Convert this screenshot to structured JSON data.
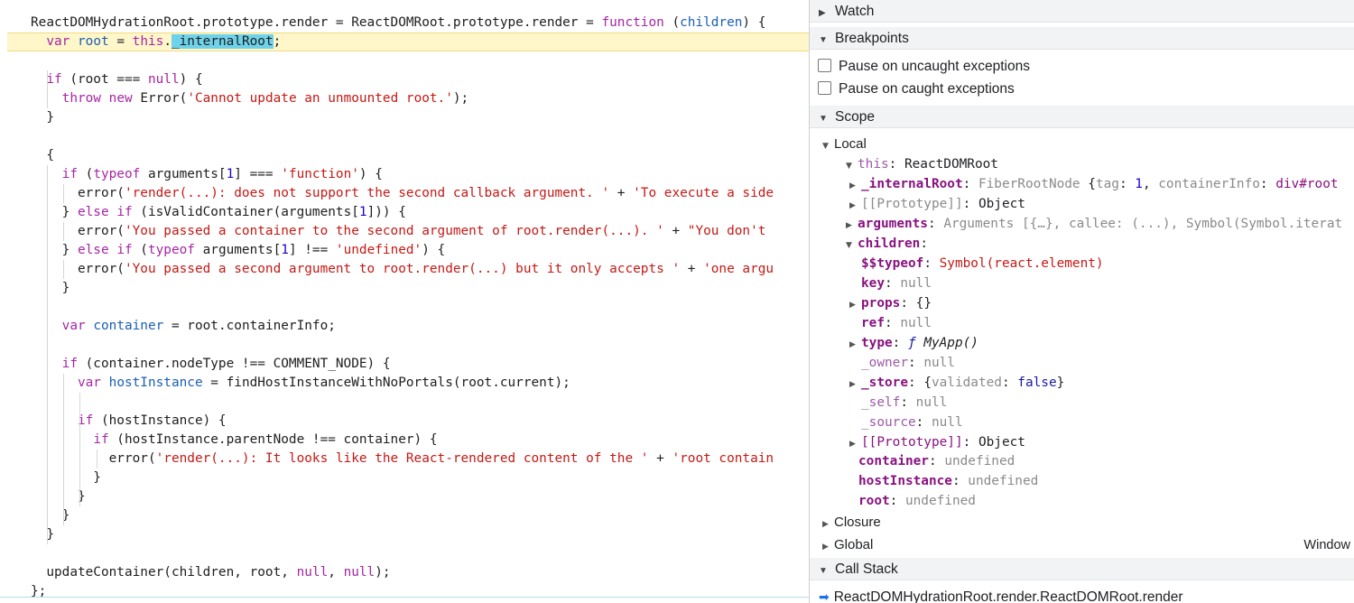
{
  "editor": {
    "lines": [
      [
        {
          "t": "ReactDOMHydrationRoot.prototype.render = ReactDOMRoot.prototype.render = "
        },
        {
          "t": "function",
          "c": "kw"
        },
        {
          "t": " ("
        },
        {
          "t": "children",
          "c": "var"
        },
        {
          "t": ") {"
        }
      ],
      [
        {
          "t": "  "
        },
        {
          "t": "var",
          "c": "kw"
        },
        {
          "t": " "
        },
        {
          "t": "root",
          "c": "var"
        },
        {
          "t": " = "
        },
        {
          "t": "this",
          "c": "kw"
        },
        {
          "t": "."
        },
        {
          "t": "_internalRoot",
          "c": "sel"
        },
        {
          "t": ";"
        }
      ],
      [
        {
          "t": ""
        }
      ],
      [
        {
          "t": "  "
        },
        {
          "t": "if",
          "c": "kw"
        },
        {
          "t": " (root === "
        },
        {
          "t": "null",
          "c": "kw"
        },
        {
          "t": ") {"
        }
      ],
      [
        {
          "t": "    "
        },
        {
          "t": "throw",
          "c": "kw"
        },
        {
          "t": " "
        },
        {
          "t": "new",
          "c": "kw"
        },
        {
          "t": " Error("
        },
        {
          "t": "'Cannot update an unmounted root.'",
          "c": "str"
        },
        {
          "t": ");"
        }
      ],
      [
        {
          "t": "  }"
        }
      ],
      [
        {
          "t": ""
        }
      ],
      [
        {
          "t": "  {"
        }
      ],
      [
        {
          "t": "    "
        },
        {
          "t": "if",
          "c": "kw"
        },
        {
          "t": " ("
        },
        {
          "t": "typeof",
          "c": "kw"
        },
        {
          "t": " arguments["
        },
        {
          "t": "1",
          "c": "num"
        },
        {
          "t": "] === "
        },
        {
          "t": "'function'",
          "c": "str"
        },
        {
          "t": ") {"
        }
      ],
      [
        {
          "t": "      error("
        },
        {
          "t": "'render(...): does not support the second callback argument. '",
          "c": "str"
        },
        {
          "t": " + "
        },
        {
          "t": "'To execute a side",
          "c": "str"
        }
      ],
      [
        {
          "t": "    } "
        },
        {
          "t": "else",
          "c": "kw"
        },
        {
          "t": " "
        },
        {
          "t": "if",
          "c": "kw"
        },
        {
          "t": " (isValidContainer(arguments["
        },
        {
          "t": "1",
          "c": "num"
        },
        {
          "t": "])) {"
        }
      ],
      [
        {
          "t": "      error("
        },
        {
          "t": "'You passed a container to the second argument of root.render(...). '",
          "c": "str"
        },
        {
          "t": " + "
        },
        {
          "t": "\"You don't",
          "c": "str"
        }
      ],
      [
        {
          "t": "    } "
        },
        {
          "t": "else",
          "c": "kw"
        },
        {
          "t": " "
        },
        {
          "t": "if",
          "c": "kw"
        },
        {
          "t": " ("
        },
        {
          "t": "typeof",
          "c": "kw"
        },
        {
          "t": " arguments["
        },
        {
          "t": "1",
          "c": "num"
        },
        {
          "t": "] !== "
        },
        {
          "t": "'undefined'",
          "c": "str"
        },
        {
          "t": ") {"
        }
      ],
      [
        {
          "t": "      error("
        },
        {
          "t": "'You passed a second argument to root.render(...) but it only accepts '",
          "c": "str"
        },
        {
          "t": " + "
        },
        {
          "t": "'one argu",
          "c": "str"
        }
      ],
      [
        {
          "t": "    }"
        }
      ],
      [
        {
          "t": ""
        }
      ],
      [
        {
          "t": "    "
        },
        {
          "t": "var",
          "c": "kw"
        },
        {
          "t": " "
        },
        {
          "t": "container",
          "c": "var"
        },
        {
          "t": " = root.containerInfo;"
        }
      ],
      [
        {
          "t": ""
        }
      ],
      [
        {
          "t": "    "
        },
        {
          "t": "if",
          "c": "kw"
        },
        {
          "t": " (container.nodeType !== COMMENT_NODE) {"
        }
      ],
      [
        {
          "t": "      "
        },
        {
          "t": "var",
          "c": "kw"
        },
        {
          "t": " "
        },
        {
          "t": "hostInstance",
          "c": "var"
        },
        {
          "t": " = findHostInstanceWithNoPortals(root.current);"
        }
      ],
      [
        {
          "t": ""
        }
      ],
      [
        {
          "t": "      "
        },
        {
          "t": "if",
          "c": "kw"
        },
        {
          "t": " (hostInstance) {"
        }
      ],
      [
        {
          "t": "        "
        },
        {
          "t": "if",
          "c": "kw"
        },
        {
          "t": " (hostInstance.parentNode !== container) {"
        }
      ],
      [
        {
          "t": "          error("
        },
        {
          "t": "'render(...): It looks like the React-rendered content of the '",
          "c": "str"
        },
        {
          "t": " + "
        },
        {
          "t": "'root contain",
          "c": "str"
        }
      ],
      [
        {
          "t": "        }"
        }
      ],
      [
        {
          "t": "      }"
        }
      ],
      [
        {
          "t": "    }"
        }
      ],
      [
        {
          "t": "  }"
        }
      ],
      [
        {
          "t": ""
        }
      ],
      [
        {
          "t": "  updateContainer(children, root, "
        },
        {
          "t": "null",
          "c": "kw"
        },
        {
          "t": ", "
        },
        {
          "t": "null",
          "c": "kw"
        },
        {
          "t": ");"
        }
      ],
      [
        {
          "t": "};"
        }
      ]
    ]
  },
  "debugger": {
    "watch_label": "Watch",
    "breakpoints_label": "Breakpoints",
    "pause_uncaught": "Pause on uncaught exceptions",
    "pause_caught": "Pause on caught exceptions",
    "scope_label": "Scope",
    "callstack_label": "Call Stack",
    "callframe": "ReactDOMHydrationRoot.render.ReactDOMRoot.render",
    "scope_rows": [
      {
        "indent": 0,
        "arrow": "down",
        "mono": false,
        "parts": [
          {
            "t": "Local"
          }
        ]
      },
      {
        "indent": 1,
        "arrow": "down",
        "parts": [
          {
            "t": "this",
            "c": "kd"
          },
          {
            "t": ": "
          },
          {
            "t": "ReactDOMRoot",
            "c": "obj"
          }
        ]
      },
      {
        "indent": 2,
        "arrow": "right",
        "parts": [
          {
            "t": "_internalRoot",
            "c": "k"
          },
          {
            "t": ": "
          },
          {
            "t": "FiberRootNode ",
            "c": "gray"
          },
          {
            "t": "{"
          },
          {
            "t": "tag",
            "c": "gray"
          },
          {
            "t": ": "
          },
          {
            "t": "1",
            "c": "num"
          },
          {
            "t": ", "
          },
          {
            "t": "containerInfo",
            "c": "gray"
          },
          {
            "t": ": "
          },
          {
            "t": "div#root",
            "c": "kn"
          }
        ]
      },
      {
        "indent": 2,
        "arrow": "right",
        "parts": [
          {
            "t": "[[Prototype]]",
            "c": "gray"
          },
          {
            "t": ": "
          },
          {
            "t": "Object",
            "c": "obj"
          }
        ]
      },
      {
        "indent": 1,
        "arrow": "right",
        "parts": [
          {
            "t": "arguments",
            "c": "k"
          },
          {
            "t": ": "
          },
          {
            "t": "Arguments ",
            "c": "gray"
          },
          {
            "t": "[{…}, ",
            "c": "gray"
          },
          {
            "t": "callee",
            "c": "gray"
          },
          {
            "t": ": (...), Symbol(Symbol.iterat",
            "c": "gray"
          }
        ]
      },
      {
        "indent": 1,
        "arrow": "down",
        "parts": [
          {
            "t": "children",
            "c": "k"
          },
          {
            "t": ":"
          }
        ]
      },
      {
        "indent": 2,
        "arrow": "",
        "parts": [
          {
            "t": "$$typeof",
            "c": "k"
          },
          {
            "t": ": "
          },
          {
            "t": "Symbol(react.element)",
            "c": "str"
          }
        ]
      },
      {
        "indent": 2,
        "arrow": "",
        "parts": [
          {
            "t": "key",
            "c": "k"
          },
          {
            "t": ": "
          },
          {
            "t": "null",
            "c": "gray"
          }
        ]
      },
      {
        "indent": 2,
        "arrow": "right",
        "parts": [
          {
            "t": "props",
            "c": "k"
          },
          {
            "t": ": "
          },
          {
            "t": "{}"
          }
        ]
      },
      {
        "indent": 2,
        "arrow": "",
        "parts": [
          {
            "t": "ref",
            "c": "k"
          },
          {
            "t": ": "
          },
          {
            "t": "null",
            "c": "gray"
          }
        ]
      },
      {
        "indent": 2,
        "arrow": "right",
        "parts": [
          {
            "t": "type",
            "c": "k"
          },
          {
            "t": ": "
          },
          {
            "t": "ƒ ",
            "c": "f"
          },
          {
            "t": "MyApp()",
            "c": "fn"
          }
        ]
      },
      {
        "indent": 2,
        "arrow": "",
        "parts": [
          {
            "t": "_owner",
            "c": "kd"
          },
          {
            "t": ": "
          },
          {
            "t": "null",
            "c": "gray"
          }
        ]
      },
      {
        "indent": 2,
        "arrow": "right",
        "parts": [
          {
            "t": "_store",
            "c": "k"
          },
          {
            "t": ": "
          },
          {
            "t": "{"
          },
          {
            "t": "validated",
            "c": "gray"
          },
          {
            "t": ": "
          },
          {
            "t": "false",
            "c": "kw"
          },
          {
            "t": "}"
          }
        ]
      },
      {
        "indent": 2,
        "arrow": "",
        "parts": [
          {
            "t": "_self",
            "c": "kd"
          },
          {
            "t": ": "
          },
          {
            "t": "null",
            "c": "gray"
          }
        ]
      },
      {
        "indent": 2,
        "arrow": "",
        "parts": [
          {
            "t": "_source",
            "c": "kd"
          },
          {
            "t": ": "
          },
          {
            "t": "null",
            "c": "gray"
          }
        ]
      },
      {
        "indent": 2,
        "arrow": "right",
        "parts": [
          {
            "t": "[[Prototype]]",
            "c": "kn"
          },
          {
            "t": ": "
          },
          {
            "t": "Object",
            "c": "obj"
          }
        ]
      },
      {
        "indent": 1,
        "arrow": "",
        "parts": [
          {
            "t": "container",
            "c": "k"
          },
          {
            "t": ": "
          },
          {
            "t": "undefined",
            "c": "gray"
          }
        ]
      },
      {
        "indent": 1,
        "arrow": "",
        "parts": [
          {
            "t": "hostInstance",
            "c": "k"
          },
          {
            "t": ": "
          },
          {
            "t": "undefined",
            "c": "gray"
          }
        ]
      },
      {
        "indent": 1,
        "arrow": "",
        "parts": [
          {
            "t": "root",
            "c": "k"
          },
          {
            "t": ": "
          },
          {
            "t": "undefined",
            "c": "gray"
          }
        ]
      },
      {
        "indent": 0,
        "arrow": "right",
        "mono": false,
        "parts": [
          {
            "t": "Closure"
          }
        ]
      },
      {
        "indent": 0,
        "arrow": "right",
        "mono": false,
        "parts": [
          {
            "t": "Global"
          }
        ],
        "right": "Window"
      }
    ]
  },
  "colors": {
    "highlight_line": "#fff6c9",
    "selection": "#6ed3ea",
    "section_header": "#f1f3f4"
  }
}
